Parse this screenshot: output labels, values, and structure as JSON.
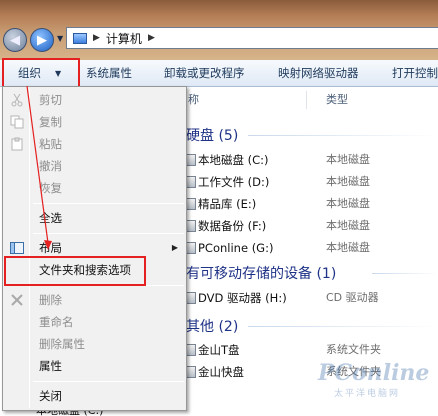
{
  "address": {
    "crumb": "计算机"
  },
  "toolbar": {
    "organize": "组织",
    "system_properties": "系统属性",
    "uninstall": "卸载或更改程序",
    "map_drive": "映射网络驱动器",
    "open_control": "打开控制"
  },
  "columns": {
    "name": "称",
    "type": "类型"
  },
  "groups": {
    "hdd": "硬盘 (5)",
    "removable": "有可移动存储的设备 (1)",
    "other": "其他 (2)"
  },
  "drives": [
    {
      "name": "本地磁盘 (C:)",
      "type": "本地磁盘"
    },
    {
      "name": "工作文件 (D:)",
      "type": "本地磁盘"
    },
    {
      "name": "精品库 (E:)",
      "type": "本地磁盘"
    },
    {
      "name": "数据备份 (F:)",
      "type": "本地磁盘"
    },
    {
      "name": "PConline (G:)",
      "type": "本地磁盘"
    }
  ],
  "removable": [
    {
      "name": "DVD 驱动器 (H:)",
      "type": "CD 驱动器"
    }
  ],
  "other": [
    {
      "name": "金山T盘",
      "type": "系统文件夹"
    },
    {
      "name": "金山快盘",
      "type": "系统文件夹"
    }
  ],
  "menu": {
    "cut": "剪切",
    "copy": "复制",
    "paste": "粘贴",
    "undo": "撤消",
    "redo": "恢复",
    "select_all": "全选",
    "layout": "布局",
    "folder_options": "文件夹和搜索选项",
    "delete": "删除",
    "rename": "重命名",
    "remove_props": "删除属性",
    "properties": "属性",
    "close": "关闭"
  },
  "behind_menu": "本地磁盘 (C:)",
  "watermark": {
    "brand": "PConline",
    "sub": "太平洋电脑网"
  },
  "colors": {
    "highlight_box": "#e52020",
    "group_title": "#1e3287"
  }
}
